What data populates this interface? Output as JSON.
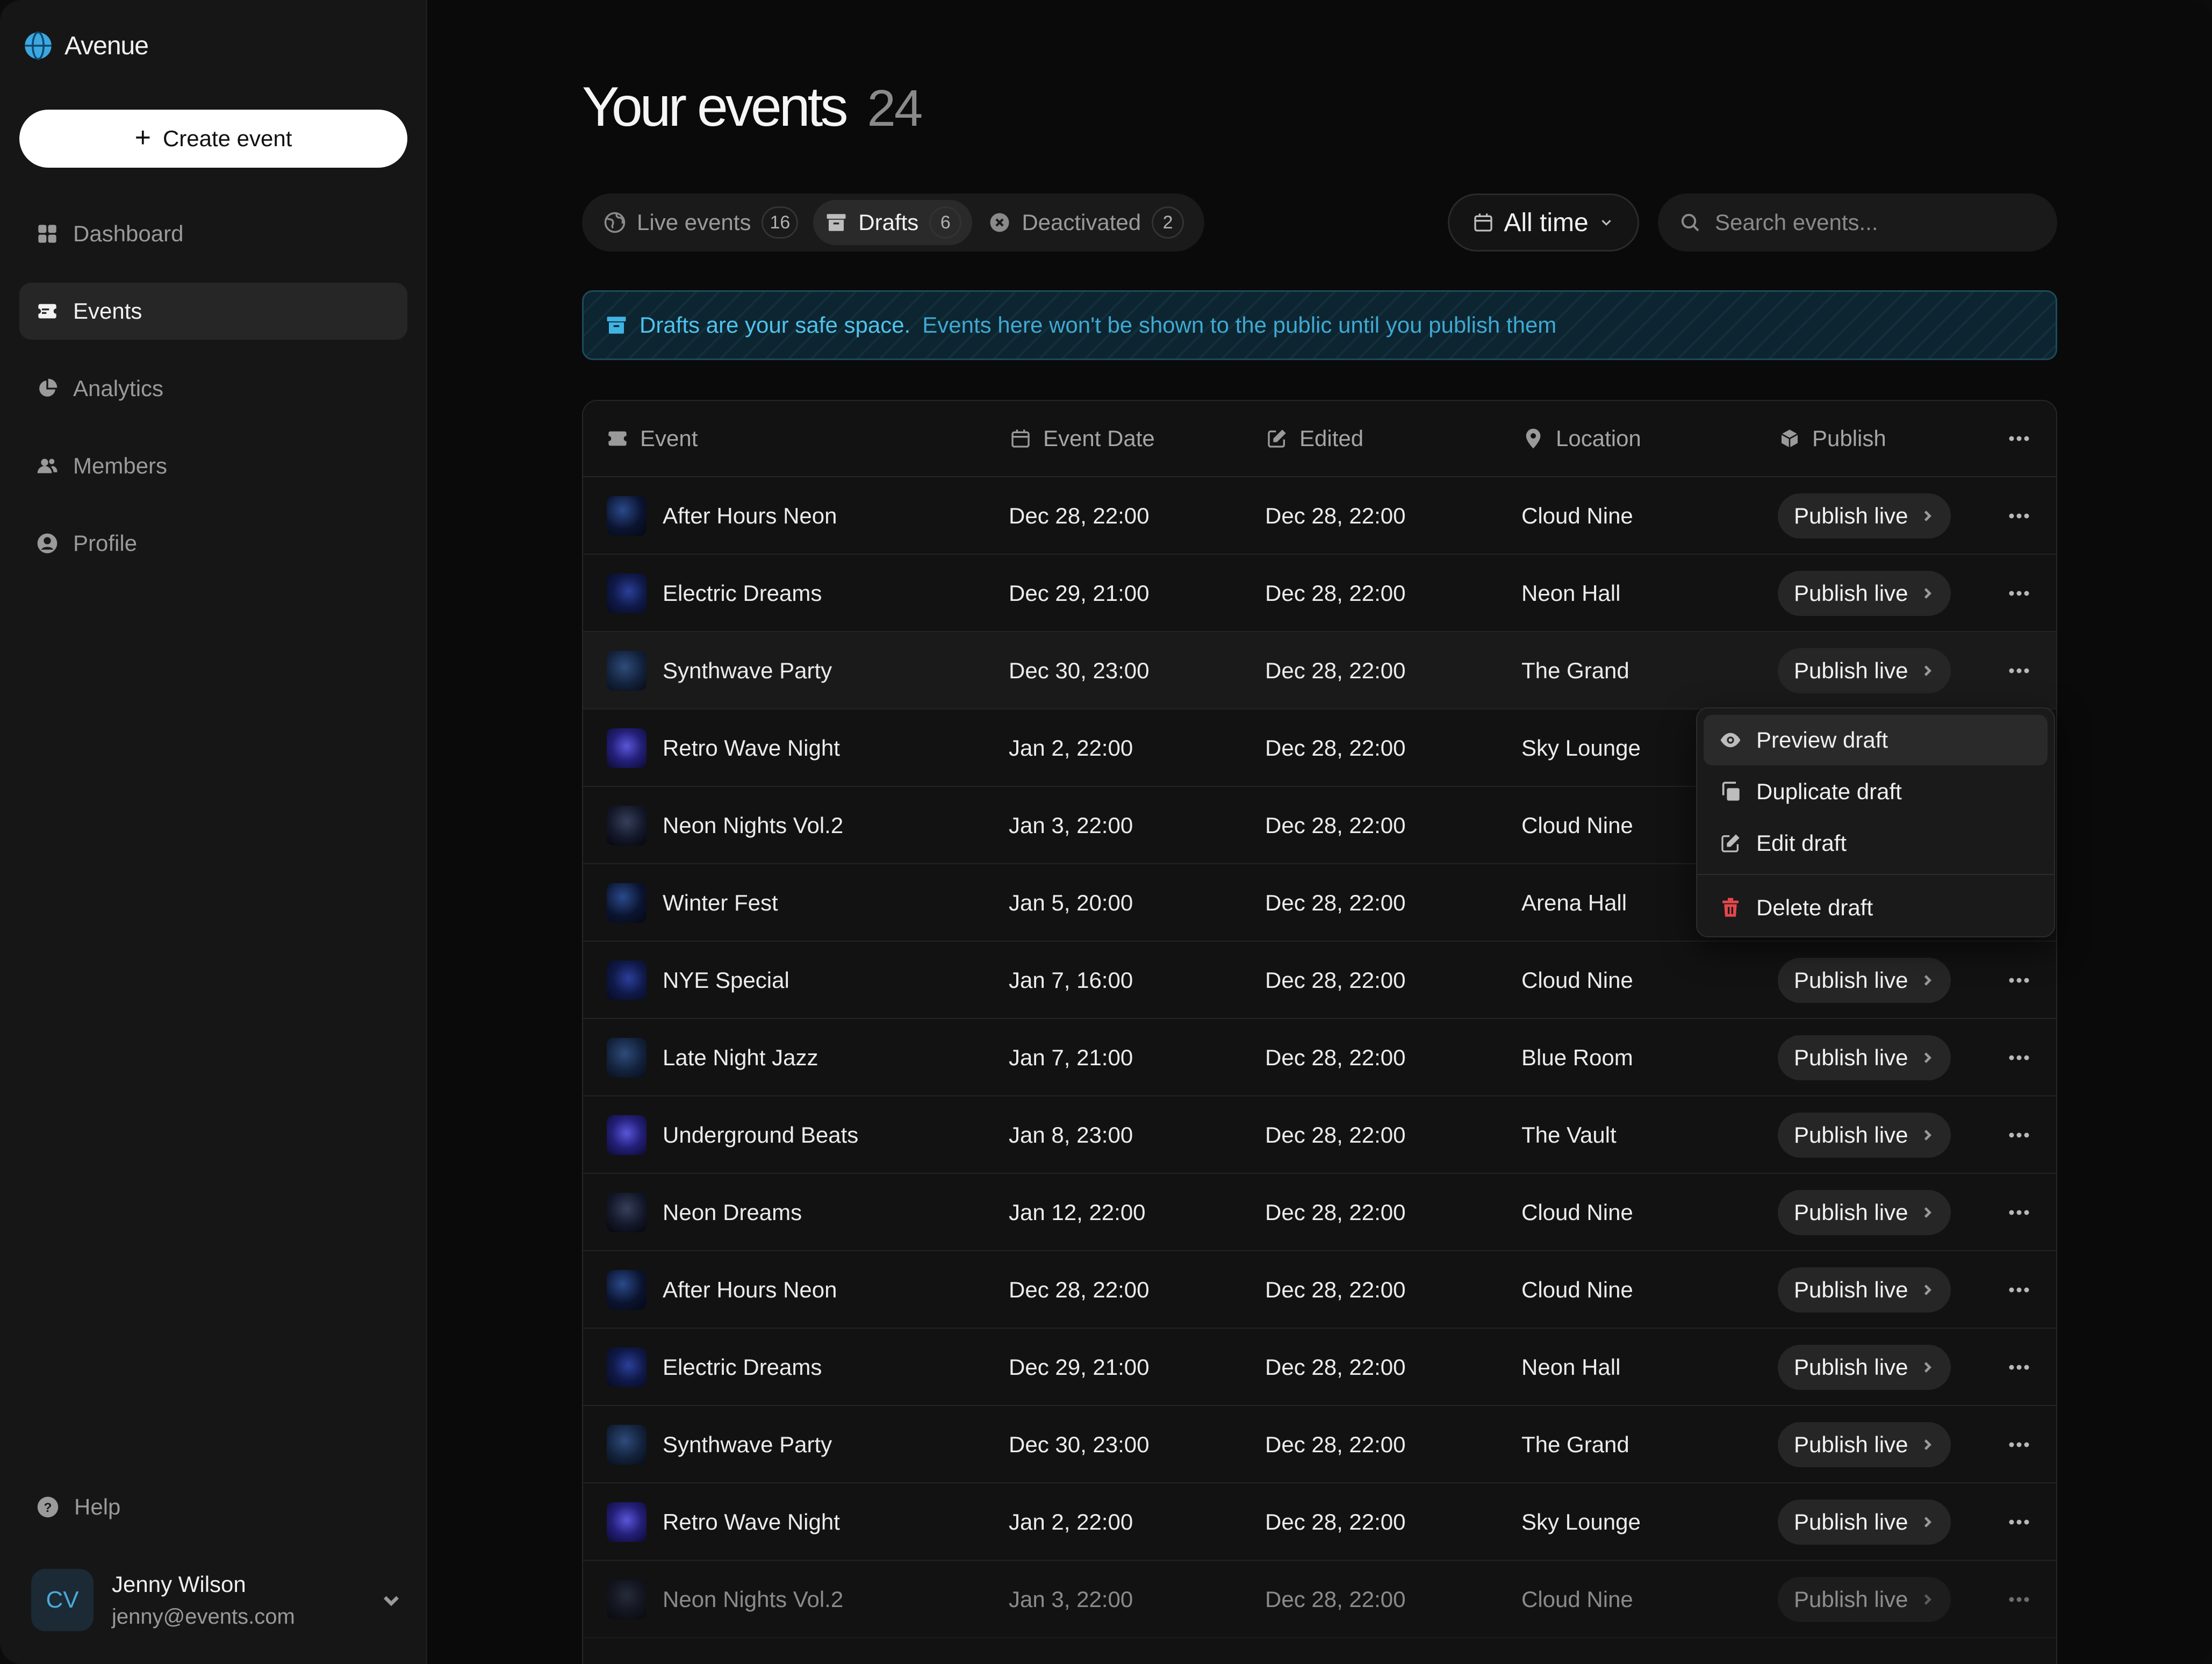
{
  "app": {
    "name": "Avenue"
  },
  "sidebar": {
    "create_label": "Create event",
    "items": [
      {
        "label": "Dashboard",
        "icon": "grid-icon",
        "active": false
      },
      {
        "label": "Events",
        "icon": "ticket-icon",
        "active": true
      },
      {
        "label": "Analytics",
        "icon": "pie-chart-icon",
        "active": false
      },
      {
        "label": "Members",
        "icon": "users-icon",
        "active": false
      },
      {
        "label": "Profile",
        "icon": "user-circle-icon",
        "active": false
      }
    ],
    "help_label": "Help",
    "user": {
      "initials": "CV",
      "name": "Jenny Wilson",
      "email": "jenny@events.com"
    }
  },
  "page": {
    "title": "Your events",
    "count": "24"
  },
  "tabs": [
    {
      "label": "Live events",
      "count": "16",
      "icon": "globe-icon",
      "active": false
    },
    {
      "label": "Drafts",
      "count": "6",
      "icon": "archive-icon",
      "active": true
    },
    {
      "label": "Deactivated",
      "count": "2",
      "icon": "x-circle-icon",
      "active": false
    }
  ],
  "time_filter": {
    "label": "All time"
  },
  "search": {
    "placeholder": "Search events..."
  },
  "banner": {
    "strong": "Drafts are your safe space.",
    "text": "Events here won't be shown to the public until you publish them"
  },
  "table": {
    "columns": [
      "Event",
      "Event Date",
      "Edited",
      "Location",
      "Publish"
    ],
    "publish_label": "Publish live",
    "rows": [
      {
        "event": "After Hours Neon",
        "date": "Dec 28, 22:00",
        "edited": "Dec 28, 22:00",
        "location": "Cloud Nine"
      },
      {
        "event": "Electric Dreams",
        "date": "Dec 29, 21:00",
        "edited": "Dec 28, 22:00",
        "location": "Neon Hall"
      },
      {
        "event": "Synthwave Party",
        "date": "Dec 30, 23:00",
        "edited": "Dec 28, 22:00",
        "location": "The Grand"
      },
      {
        "event": "Retro Wave Night",
        "date": "Jan 2, 22:00",
        "edited": "Dec 28, 22:00",
        "location": "Sky Lounge"
      },
      {
        "event": "Neon Nights Vol.2",
        "date": "Jan 3, 22:00",
        "edited": "Dec 28, 22:00",
        "location": "Cloud Nine"
      },
      {
        "event": "Winter Fest",
        "date": "Jan 5, 20:00",
        "edited": "Dec 28, 22:00",
        "location": "Arena Hall"
      },
      {
        "event": "NYE Special",
        "date": "Jan 7, 16:00",
        "edited": "Dec 28, 22:00",
        "location": "Cloud Nine"
      },
      {
        "event": "Late Night Jazz",
        "date": "Jan 7, 21:00",
        "edited": "Dec 28, 22:00",
        "location": "Blue Room"
      },
      {
        "event": "Underground Beats",
        "date": "Jan 8, 23:00",
        "edited": "Dec 28, 22:00",
        "location": "The Vault"
      },
      {
        "event": "Neon Dreams",
        "date": "Jan 12, 22:00",
        "edited": "Dec 28, 22:00",
        "location": "Cloud Nine"
      },
      {
        "event": "After Hours Neon",
        "date": "Dec 28, 22:00",
        "edited": "Dec 28, 22:00",
        "location": "Cloud Nine"
      },
      {
        "event": "Electric Dreams",
        "date": "Dec 29, 21:00",
        "edited": "Dec 28, 22:00",
        "location": "Neon Hall"
      },
      {
        "event": "Synthwave Party",
        "date": "Dec 30, 23:00",
        "edited": "Dec 28, 22:00",
        "location": "The Grand"
      },
      {
        "event": "Retro Wave Night",
        "date": "Jan 2, 22:00",
        "edited": "Dec 28, 22:00",
        "location": "Sky Lounge"
      },
      {
        "event": "Neon Nights Vol.2",
        "date": "Jan 3, 22:00",
        "edited": "Dec 28, 22:00",
        "location": "Cloud Nine"
      }
    ]
  },
  "context_menu": {
    "items": [
      {
        "label": "Preview draft",
        "icon": "eye-icon"
      },
      {
        "label": "Duplicate draft",
        "icon": "copy-icon"
      },
      {
        "label": "Edit draft",
        "icon": "edit-icon"
      },
      {
        "label": "Delete draft",
        "icon": "trash-icon",
        "color": "#e5484d"
      }
    ]
  },
  "colors": {
    "accent": "#4fc3ee",
    "danger": "#e5484d",
    "background": "#0a0a0a"
  }
}
